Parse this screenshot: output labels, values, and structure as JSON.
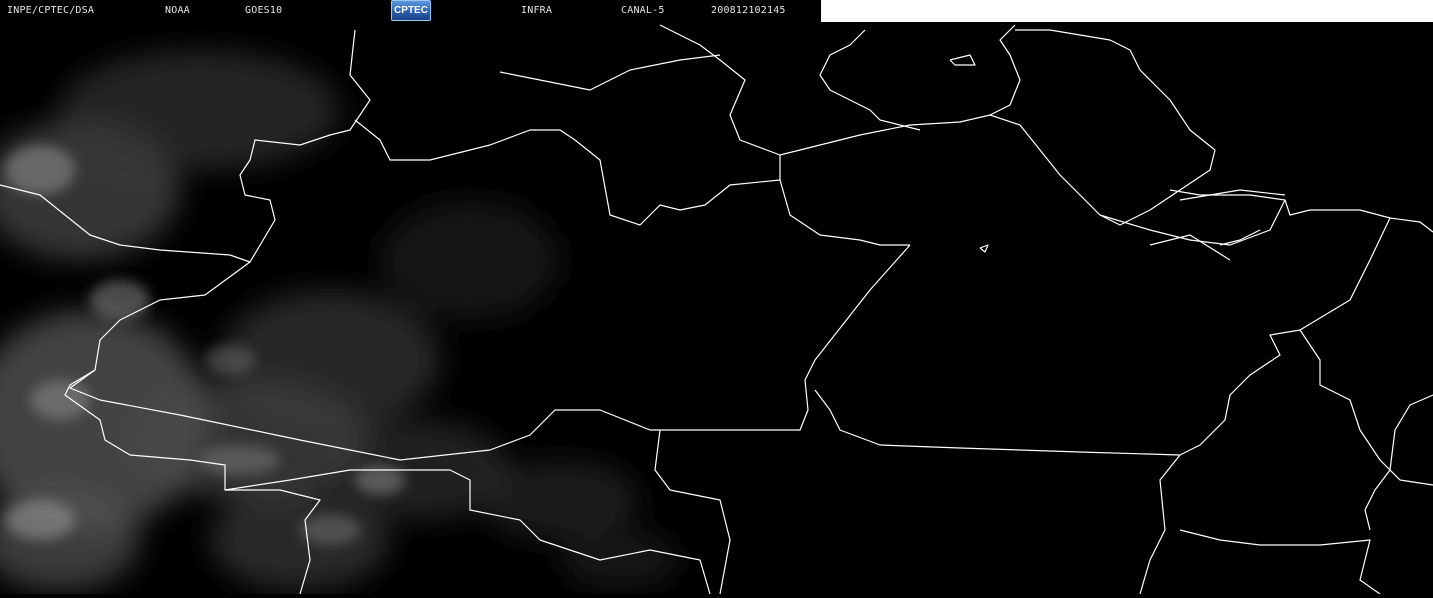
{
  "header": {
    "institution": "INPE/CPTEC/DSA",
    "agency": "NOAA",
    "satellite": "GOES10",
    "logo_text": "CPTEC",
    "product": "INFRA",
    "channel": "CANAL-5",
    "timestamp": "200812102145"
  },
  "colors": {
    "background": "#000000",
    "border_lines": "#ffffff",
    "header_text": "#e6e6e6",
    "cloud_tone": "#6a6a6a"
  }
}
